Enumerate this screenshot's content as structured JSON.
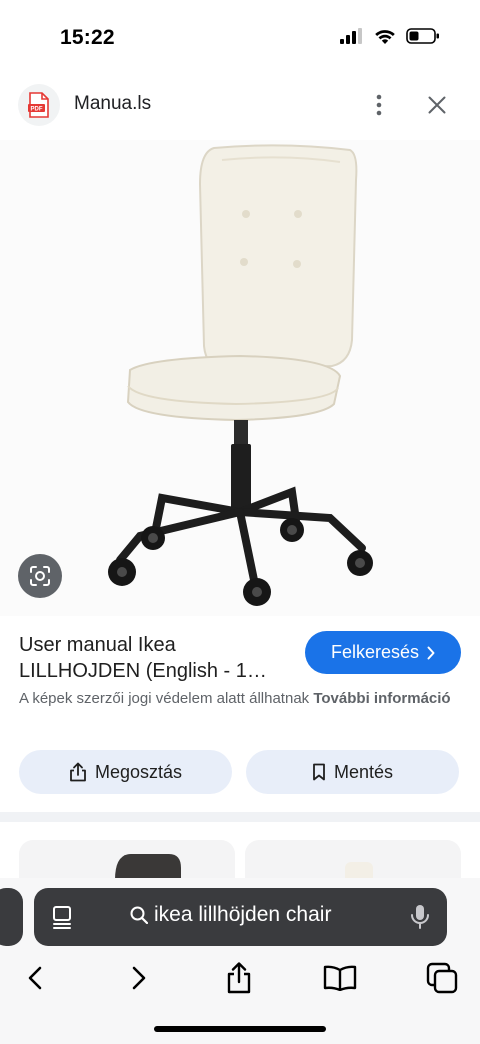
{
  "status": {
    "time": "15:22"
  },
  "header": {
    "site_name": "Manua.ls",
    "pdf_badge": "PDF"
  },
  "result": {
    "title_line1": "User manual Ikea",
    "title_line2": "LILLHOJDEN (English - 1…",
    "visit_label": "Felkeresés",
    "copyright_text": "A képek szerzői jogi védelem alatt állhatnak",
    "copyright_link": "További információ"
  },
  "actions": {
    "share_label": "Megosztás",
    "save_label": "Mentés"
  },
  "search": {
    "query": "ikea lillhöjden chair"
  },
  "colors": {
    "accent": "#1a73e8",
    "chip_bg": "#e8eef9",
    "url_bar": "#3a3b3e"
  },
  "icons": [
    "signal-icon",
    "wifi-icon",
    "battery-icon",
    "pdf-icon",
    "more-icon",
    "close-icon",
    "lens-icon",
    "chevron-right-icon",
    "share-icon",
    "bookmark-icon",
    "tabs-icon",
    "search-icon",
    "mic-icon",
    "back-icon",
    "forward-icon",
    "share-sheet-icon",
    "book-icon",
    "tab-overview-icon"
  ]
}
